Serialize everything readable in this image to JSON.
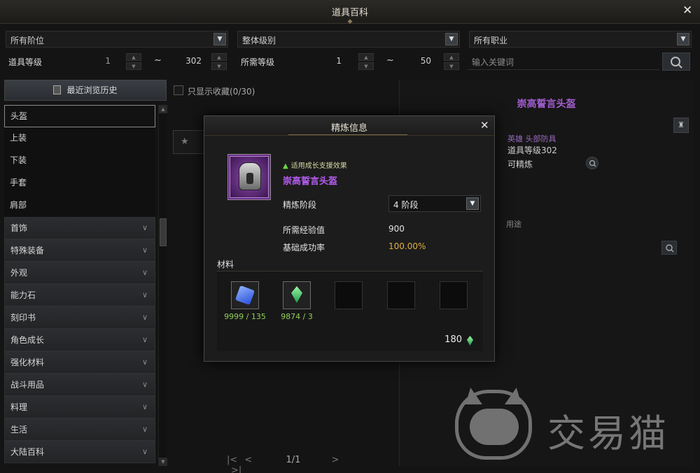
{
  "window": {
    "title": "道具百科"
  },
  "filters": {
    "tier_select": "所有阶位",
    "level_type_select": "整体级别",
    "class_select": "所有职业",
    "item_level_label": "道具等级",
    "item_level_min": "1",
    "item_level_max": "302",
    "req_level_label": "所需等级",
    "req_level_min": "1",
    "req_level_max": "50",
    "tilde": "~",
    "search_placeholder": "输入关键词"
  },
  "sidebar": {
    "history_button": "最近浏览历史",
    "items": [
      {
        "label": "头盔",
        "type": "sub",
        "selected": true
      },
      {
        "label": "上装",
        "type": "sub"
      },
      {
        "label": "下装",
        "type": "sub"
      },
      {
        "label": "手套",
        "type": "sub"
      },
      {
        "label": "肩部",
        "type": "sub"
      },
      {
        "label": "首饰",
        "type": "head"
      },
      {
        "label": "特殊装备",
        "type": "head"
      },
      {
        "label": "外观",
        "type": "head"
      },
      {
        "label": "能力石",
        "type": "head"
      },
      {
        "label": "刻印书",
        "type": "head"
      },
      {
        "label": "角色成长",
        "type": "head"
      },
      {
        "label": "强化材料",
        "type": "head"
      },
      {
        "label": "战斗用品",
        "type": "head"
      },
      {
        "label": "料理",
        "type": "head"
      },
      {
        "label": "生活",
        "type": "head"
      },
      {
        "label": "大陆百科",
        "type": "head"
      }
    ]
  },
  "middle": {
    "favorites_only": "只显示收藏(0/30)",
    "page": "1/1"
  },
  "detail": {
    "item_name": "崇高誓言头盔",
    "category": "英雄 头部防具",
    "item_level": "道具等级302",
    "refinable": "可精炼",
    "tab_usage": "用途"
  },
  "popup": {
    "title": "精炼信息",
    "growth_tag": "适用成长支援效果",
    "item_name": "崇高誓言头盔",
    "stage_label": "精炼阶段",
    "stage_value": "4 阶段",
    "exp_label": "所需经验值",
    "exp_value": "900",
    "rate_label": "基础成功率",
    "rate_value": "100.00%",
    "materials_label": "材料",
    "materials": [
      {
        "icon": "blue-crystal-icon",
        "qty": "9999 / 135"
      },
      {
        "icon": "green-crystal-icon",
        "qty": "9874 / 3"
      }
    ],
    "cost": "180"
  },
  "colors": {
    "item_name": "#b45cf0",
    "rate": "#e0b040",
    "qty": "#8fd05a"
  },
  "watermark": {
    "text": "交易猫"
  }
}
